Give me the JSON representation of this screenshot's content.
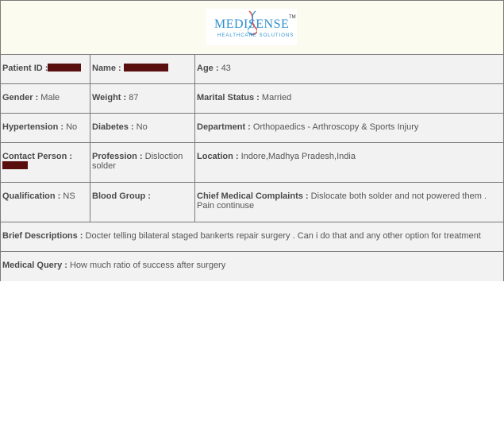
{
  "logo": {
    "wordmark": "MEDISENSE",
    "tagline": "HEALTHCARE SOLUTIONS",
    "tm": "TM"
  },
  "patient": {
    "id_label": "Patient ID :",
    "name_label": "Name :",
    "age_label": "Age :",
    "age": "43",
    "gender_label": "Gender :",
    "gender": "Male",
    "weight_label": "Weight :",
    "weight": "87",
    "marital_label": "Marital Status :",
    "marital": "Married",
    "hypertension_label": "Hypertension :",
    "hypertension": "No",
    "diabetes_label": "Diabetes :",
    "diabetes": "No",
    "department_label": "Department :",
    "department": "Orthopaedics - Arthroscopy & Sports Injury",
    "contact_label": "Contact Person :",
    "profession_label": "Profession :",
    "profession": "Disloction solder",
    "location_label": "Location :",
    "location": "Indore,Madhya Pradesh,India",
    "qualification_label": "Qualification :",
    "qualification": "NS",
    "blood_label": "Blood Group :",
    "blood": "",
    "complaints_label": "Chief Medical Complaints :",
    "complaints": "Dislocate both solder and not powered them . Pain continuse",
    "brief_label": "Brief Descriptions :",
    "brief": "Docter telling bilateral staged bankerts repair surgery . Can i do that and any other option for treatment",
    "query_label": "Medical Query :",
    "query": "How much ratio of success after surgery"
  },
  "colors": {
    "redaction": "#5a0f0f",
    "border": "#7a7a7a",
    "logo_blue": "#2d8fcf",
    "header_bg": "#fbfbef",
    "cell_bg": "#f2f2f2"
  }
}
